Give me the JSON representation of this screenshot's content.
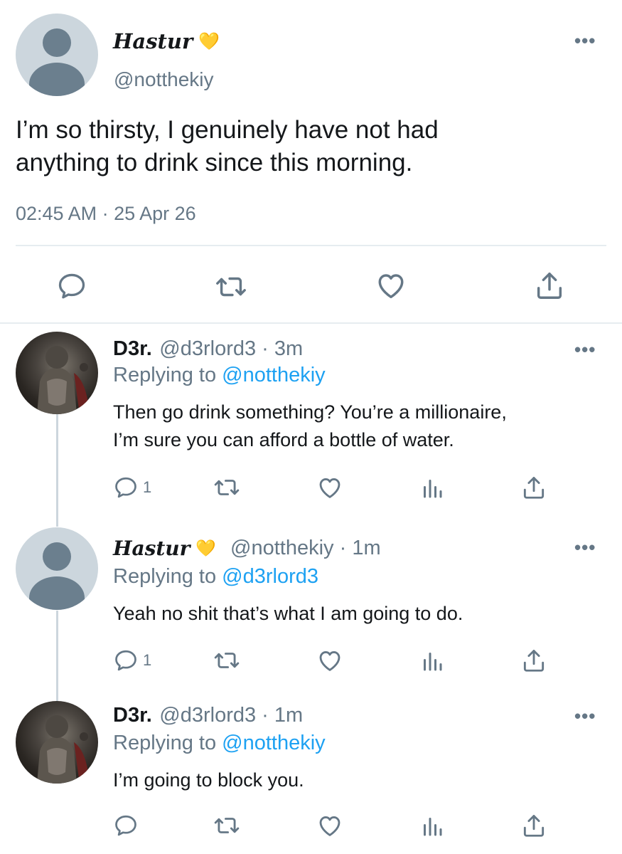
{
  "main_tweet": {
    "display_name": "Hastur",
    "badge": "💛",
    "handle": "@notthekiy",
    "text_line1": "I’m so thirsty, I genuinely have not had",
    "text_line2": "anything to drink since this morning.",
    "timestamp": "02:45 AM · 25 Apr 26"
  },
  "replies": [
    {
      "display_name": "D3r.",
      "handle_time": "@d3rlord3 · 3m",
      "replying_prefix": "Replying to ",
      "replying_to": "@notthekiy",
      "text_line1": "Then go drink something? You’re a millionaire,",
      "text_line2": "I’m sure you can afford a bottle of water.",
      "reply_count": "1"
    },
    {
      "display_name": "Hastur",
      "badge": "💛",
      "handle_time": "@notthekiy · 1m",
      "replying_prefix": "Replying to ",
      "replying_to": "@d3rlord3",
      "text_line1": "Yeah no shit that’s what I am going to do.",
      "reply_count": "1"
    },
    {
      "display_name": "D3r.",
      "handle_time": "@d3rlord3 · 1m",
      "replying_prefix": "Replying to ",
      "replying_to": "@notthekiy",
      "text_line1": "I’m going to block you."
    }
  ],
  "more_label": "•••",
  "icons": {
    "reply": "reply-icon",
    "retweet": "retweet-icon",
    "like": "heart-icon",
    "analytics": "analytics-icon",
    "share": "share-icon",
    "more": "more-icon"
  },
  "colors": {
    "link": "#1da1f2",
    "secondary_text": "#657786",
    "primary_text": "#14171a",
    "divider": "#e6ecf0"
  }
}
